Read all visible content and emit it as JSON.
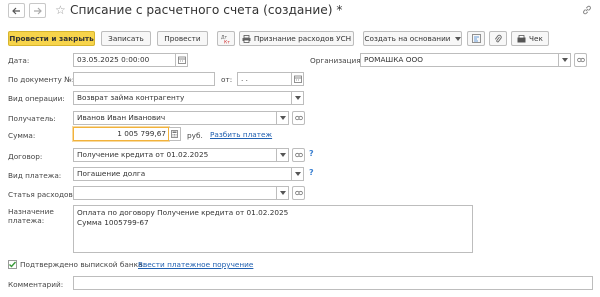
{
  "window": {
    "title": "Списание с расчетного счета (создание) *"
  },
  "toolbar": {
    "post_close": "Провести и закрыть",
    "save": "Записать",
    "post": "Провести",
    "usn_expenses": "Признание расходов УСН",
    "create_based": "Создать на основании",
    "print": "Чек"
  },
  "form": {
    "date_label": "Дата:",
    "date_value": "03.05.2025  0:00:00",
    "org_label": "Организация:",
    "org_value": "РОМАШКА ООО",
    "doc_no_label": "По документу №:",
    "doc_no_value": "",
    "from_label": "от:",
    "from_value": " .  .",
    "operation_label": "Вид операции:",
    "operation_value": "Возврат займа контрагенту",
    "recipient_label": "Получатель:",
    "recipient_value": "Иванов Иван Иванович",
    "sum_label": "Сумма:",
    "sum_value": "1 005 799,67",
    "currency": "руб.",
    "split_link": "Разбить платеж",
    "contract_label": "Договор:",
    "contract_value": "Получение кредита от 01.02.2025",
    "payment_type_label": "Вид платежа:",
    "payment_type_value": "Погашение долга",
    "expense_label": "Статья расходов:",
    "expense_value": "",
    "purpose_label_1": "Назначение",
    "purpose_label_2": "платежа:",
    "purpose_line_1": "Оплата по договору Получение кредита от 01.02.2025",
    "purpose_line_2": "Сумма 1005799-67",
    "confirmed_label": "Подтверждено выпиской банка:",
    "confirmed_checked": true,
    "enter_order_link": "Ввести платежное поручение",
    "comment_label": "Комментарий:",
    "comment_value": "",
    "help_mark": "?"
  }
}
